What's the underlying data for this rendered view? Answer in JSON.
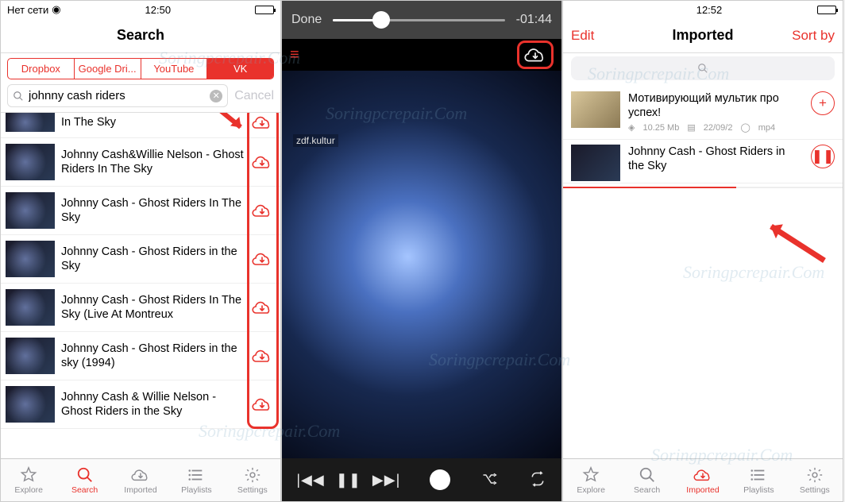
{
  "search_screen": {
    "status": {
      "carrier": "Нет сети",
      "time": "12:50"
    },
    "title": "Search",
    "source_tabs": [
      {
        "label": "Dropbox",
        "active": false
      },
      {
        "label": "Google Dri...",
        "active": false
      },
      {
        "label": "YouTube",
        "active": false
      },
      {
        "label": "VK",
        "active": true
      }
    ],
    "search_value": "johnny cash riders",
    "cancel_label": "Cancel",
    "results": [
      {
        "title": "In The Sky"
      },
      {
        "title": "Johnny Cash&Willie Nelson - Ghost Riders In The Sky"
      },
      {
        "title": "Johnny Cash - Ghost Riders In The Sky"
      },
      {
        "title": "Johnny Cash - Ghost Riders in the Sky"
      },
      {
        "title": "Johnny Cash - Ghost Riders In The Sky (Live At Montreux"
      },
      {
        "title": "Johnny Cash - Ghost Riders in the sky (1994)"
      },
      {
        "title": "Johnny Cash & Willie Nelson - Ghost Riders in the Sky"
      }
    ]
  },
  "player_screen": {
    "done_label": "Done",
    "time_remaining": "-01:44",
    "channel_tag": "zdf.kultur"
  },
  "imported_screen": {
    "status": {
      "time": "12:52"
    },
    "edit_label": "Edit",
    "title": "Imported",
    "sort_label": "Sort by",
    "items": [
      {
        "title": "Мотивирующий мультик про успех!",
        "size": "10.25 Mb",
        "date": "22/09/2",
        "format": "mp4",
        "action": "add"
      },
      {
        "title": "Johnny Cash - Ghost Riders in the Sky",
        "action": "pause",
        "progress": 0.62
      }
    ]
  },
  "tabbar": {
    "items": [
      {
        "label": "Explore"
      },
      {
        "label": "Search"
      },
      {
        "label": "Imported"
      },
      {
        "label": "Playlists"
      },
      {
        "label": "Settings"
      }
    ]
  },
  "watermark_text": "Soringpcrepair.Com"
}
